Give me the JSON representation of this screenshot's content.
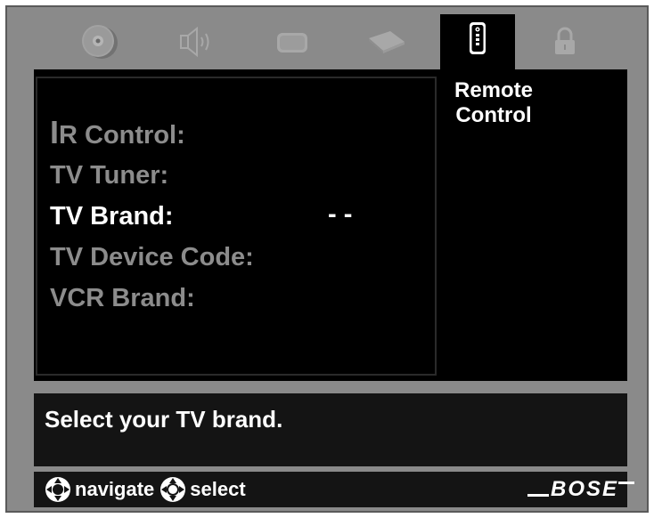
{
  "tabs": [
    {
      "name": "disc-icon",
      "active": false
    },
    {
      "name": "speaker-icon",
      "active": false
    },
    {
      "name": "screen-icon",
      "active": false
    },
    {
      "name": "cable-icon",
      "active": false
    },
    {
      "name": "remote-icon",
      "active": true
    },
    {
      "name": "lock-icon",
      "active": false
    }
  ],
  "panel": {
    "title_line1": "Remote",
    "title_line2": "Control"
  },
  "menu": {
    "items": [
      {
        "label_first": "I",
        "label_rest": "R Control:",
        "value": ""
      },
      {
        "label": "TV Tuner:",
        "value": ""
      },
      {
        "label": "TV Brand:",
        "value": "- -",
        "selected": true
      },
      {
        "label": "TV Device Code:",
        "value": ""
      },
      {
        "label": "VCR Brand:",
        "value": ""
      }
    ]
  },
  "message": {
    "text": "Select your TV brand."
  },
  "footer": {
    "navigate_label": "navigate",
    "select_label": "select",
    "logo": "BOSE"
  },
  "colors": {
    "frame": "#8a8a8a",
    "panel": "#000000",
    "selected_text": "#ffffff",
    "dim_text": "#8c8c8c",
    "message_bg": "#141414"
  }
}
